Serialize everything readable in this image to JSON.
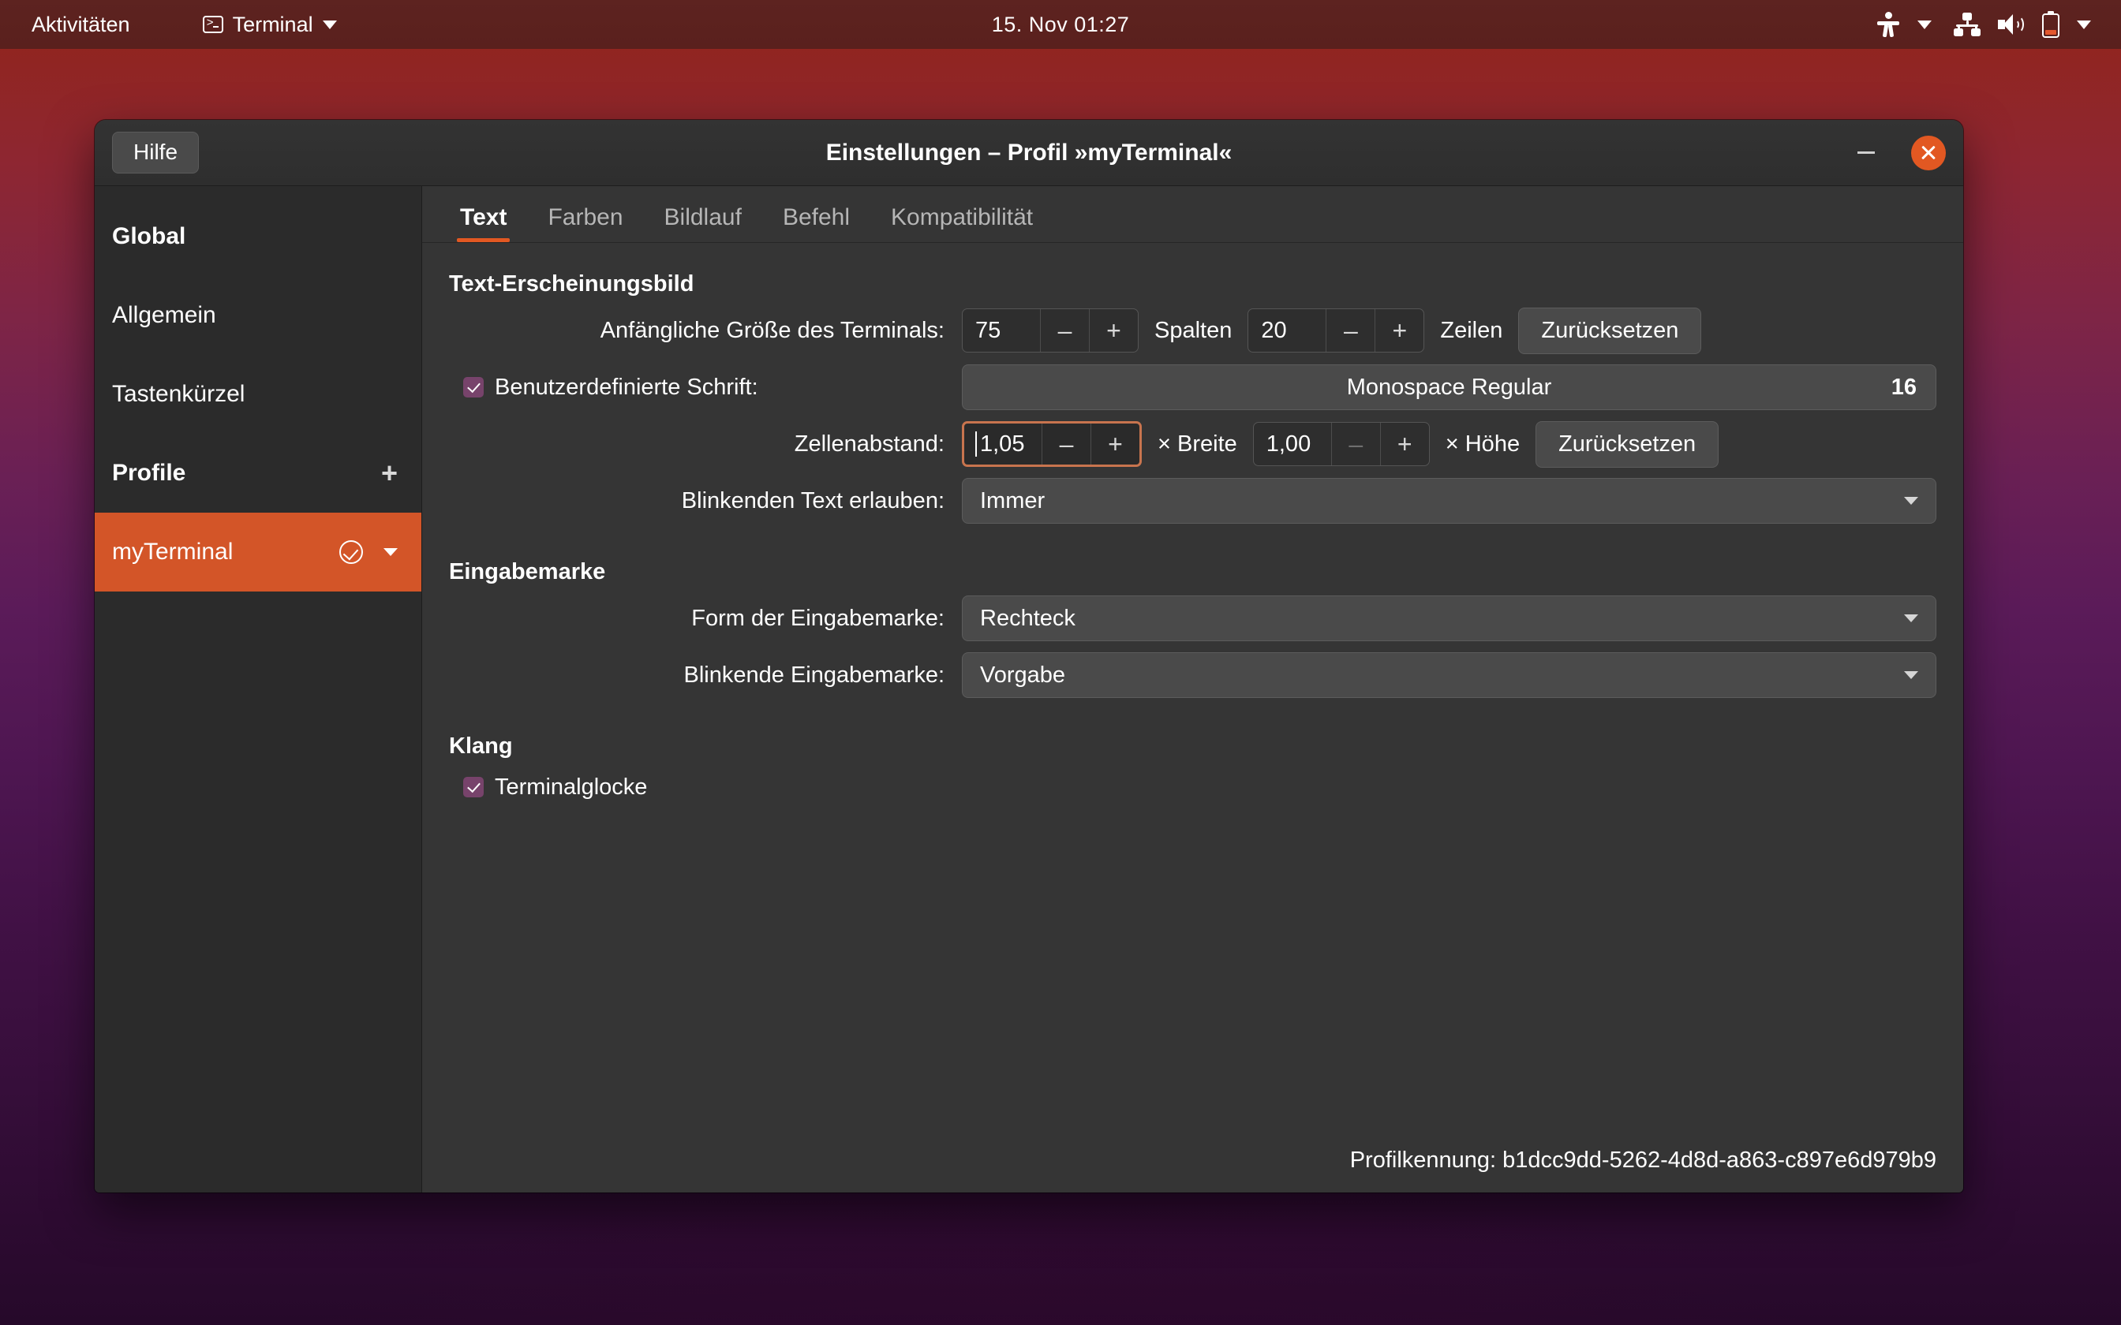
{
  "topbar": {
    "activities": "Aktivitäten",
    "app_menu": "Terminal",
    "clock": "15. Nov  01:27",
    "icons": {
      "app": "terminal-icon",
      "app_caret": "chevron-down-icon",
      "accessibility": "accessibility-icon",
      "accessibility_caret": "chevron-down-icon",
      "network": "network-icon",
      "volume": "volume-icon",
      "battery": "battery-icon",
      "system_caret": "chevron-down-icon"
    }
  },
  "window": {
    "title": "Einstellungen – Profil »myTerminal«",
    "help_label": "Hilfe",
    "minimize_label": "–",
    "close_label": "×"
  },
  "sidebar": {
    "items": [
      {
        "label": "Global",
        "type": "header"
      },
      {
        "label": "Allgemein",
        "type": "item"
      },
      {
        "label": "Tastenkürzel",
        "type": "item"
      },
      {
        "label": "Profile",
        "type": "header",
        "action": "+"
      },
      {
        "label": "myTerminal",
        "type": "profile",
        "selected": true
      }
    ]
  },
  "tabs": [
    {
      "label": "Text",
      "active": true
    },
    {
      "label": "Farben",
      "active": false
    },
    {
      "label": "Bildlauf",
      "active": false
    },
    {
      "label": "Befehl",
      "active": false
    },
    {
      "label": "Kompatibilität",
      "active": false
    }
  ],
  "panel": {
    "section_text": "Text-Erscheinungsbild",
    "initial_size": {
      "label": "Anfängliche Größe des Terminals:",
      "columns_value": "75",
      "columns_unit": "Spalten",
      "rows_value": "20",
      "rows_unit": "Zeilen",
      "reset_label": "Zurücksetzen",
      "minus": "–",
      "plus": "+"
    },
    "custom_font": {
      "label": "Benutzerdefinierte Schrift:",
      "checked": true,
      "font_name": "Monospace Regular",
      "font_size": "16"
    },
    "cell_spacing": {
      "label": "Zellenabstand:",
      "width_value": "1,05",
      "width_unit": "× Breite",
      "height_value": "1,00",
      "height_unit": "× Höhe",
      "reset_label": "Zurücksetzen",
      "minus": "–",
      "plus": "+"
    },
    "blinking_text": {
      "label": "Blinkenden Text erlauben:",
      "value": "Immer"
    },
    "section_cursor": "Eingabemarke",
    "cursor_shape": {
      "label": "Form der Eingabemarke:",
      "value": "Rechteck"
    },
    "cursor_blink": {
      "label": "Blinkende Eingabemarke:",
      "value": "Vorgabe"
    },
    "section_sound": "Klang",
    "terminal_bell": {
      "label": "Terminalglocke",
      "checked": true
    },
    "profile_id": "Profilkennung: b1dcc9dd-5262-4d8d-a863-c897e6d979b9"
  },
  "colors": {
    "accent": "#e25822",
    "selected_sidebar": "#d35528",
    "checkbox": "#77436b",
    "focus_border": "#c8744e",
    "topbar": "#5a201d"
  }
}
